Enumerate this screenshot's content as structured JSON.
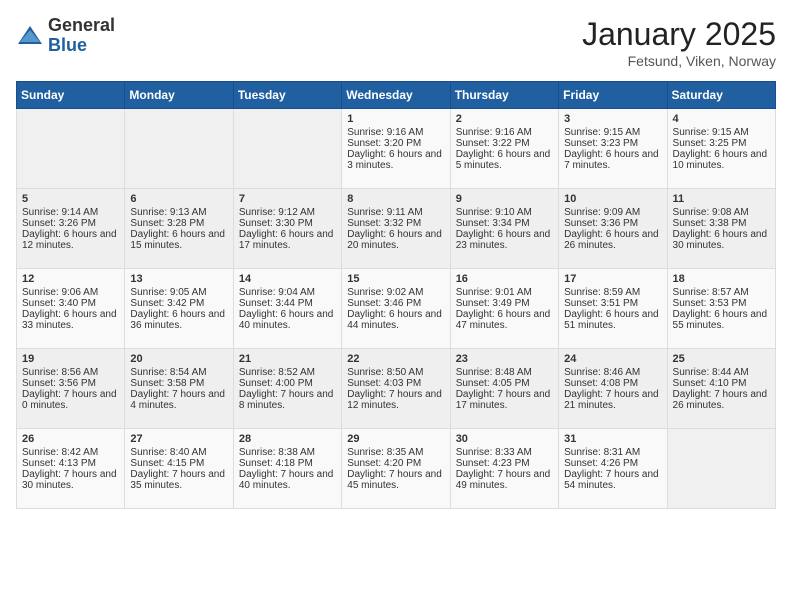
{
  "logo": {
    "general": "General",
    "blue": "Blue"
  },
  "title": {
    "month": "January 2025",
    "location": "Fetsund, Viken, Norway"
  },
  "weekdays": [
    "Sunday",
    "Monday",
    "Tuesday",
    "Wednesday",
    "Thursday",
    "Friday",
    "Saturday"
  ],
  "weeks": [
    [
      {
        "day": "",
        "sunrise": "",
        "sunset": "",
        "daylight": ""
      },
      {
        "day": "",
        "sunrise": "",
        "sunset": "",
        "daylight": ""
      },
      {
        "day": "",
        "sunrise": "",
        "sunset": "",
        "daylight": ""
      },
      {
        "day": "1",
        "sunrise": "Sunrise: 9:16 AM",
        "sunset": "Sunset: 3:20 PM",
        "daylight": "Daylight: 6 hours and 3 minutes."
      },
      {
        "day": "2",
        "sunrise": "Sunrise: 9:16 AM",
        "sunset": "Sunset: 3:22 PM",
        "daylight": "Daylight: 6 hours and 5 minutes."
      },
      {
        "day": "3",
        "sunrise": "Sunrise: 9:15 AM",
        "sunset": "Sunset: 3:23 PM",
        "daylight": "Daylight: 6 hours and 7 minutes."
      },
      {
        "day": "4",
        "sunrise": "Sunrise: 9:15 AM",
        "sunset": "Sunset: 3:25 PM",
        "daylight": "Daylight: 6 hours and 10 minutes."
      }
    ],
    [
      {
        "day": "5",
        "sunrise": "Sunrise: 9:14 AM",
        "sunset": "Sunset: 3:26 PM",
        "daylight": "Daylight: 6 hours and 12 minutes."
      },
      {
        "day": "6",
        "sunrise": "Sunrise: 9:13 AM",
        "sunset": "Sunset: 3:28 PM",
        "daylight": "Daylight: 6 hours and 15 minutes."
      },
      {
        "day": "7",
        "sunrise": "Sunrise: 9:12 AM",
        "sunset": "Sunset: 3:30 PM",
        "daylight": "Daylight: 6 hours and 17 minutes."
      },
      {
        "day": "8",
        "sunrise": "Sunrise: 9:11 AM",
        "sunset": "Sunset: 3:32 PM",
        "daylight": "Daylight: 6 hours and 20 minutes."
      },
      {
        "day": "9",
        "sunrise": "Sunrise: 9:10 AM",
        "sunset": "Sunset: 3:34 PM",
        "daylight": "Daylight: 6 hours and 23 minutes."
      },
      {
        "day": "10",
        "sunrise": "Sunrise: 9:09 AM",
        "sunset": "Sunset: 3:36 PM",
        "daylight": "Daylight: 6 hours and 26 minutes."
      },
      {
        "day": "11",
        "sunrise": "Sunrise: 9:08 AM",
        "sunset": "Sunset: 3:38 PM",
        "daylight": "Daylight: 6 hours and 30 minutes."
      }
    ],
    [
      {
        "day": "12",
        "sunrise": "Sunrise: 9:06 AM",
        "sunset": "Sunset: 3:40 PM",
        "daylight": "Daylight: 6 hours and 33 minutes."
      },
      {
        "day": "13",
        "sunrise": "Sunrise: 9:05 AM",
        "sunset": "Sunset: 3:42 PM",
        "daylight": "Daylight: 6 hours and 36 minutes."
      },
      {
        "day": "14",
        "sunrise": "Sunrise: 9:04 AM",
        "sunset": "Sunset: 3:44 PM",
        "daylight": "Daylight: 6 hours and 40 minutes."
      },
      {
        "day": "15",
        "sunrise": "Sunrise: 9:02 AM",
        "sunset": "Sunset: 3:46 PM",
        "daylight": "Daylight: 6 hours and 44 minutes."
      },
      {
        "day": "16",
        "sunrise": "Sunrise: 9:01 AM",
        "sunset": "Sunset: 3:49 PM",
        "daylight": "Daylight: 6 hours and 47 minutes."
      },
      {
        "day": "17",
        "sunrise": "Sunrise: 8:59 AM",
        "sunset": "Sunset: 3:51 PM",
        "daylight": "Daylight: 6 hours and 51 minutes."
      },
      {
        "day": "18",
        "sunrise": "Sunrise: 8:57 AM",
        "sunset": "Sunset: 3:53 PM",
        "daylight": "Daylight: 6 hours and 55 minutes."
      }
    ],
    [
      {
        "day": "19",
        "sunrise": "Sunrise: 8:56 AM",
        "sunset": "Sunset: 3:56 PM",
        "daylight": "Daylight: 7 hours and 0 minutes."
      },
      {
        "day": "20",
        "sunrise": "Sunrise: 8:54 AM",
        "sunset": "Sunset: 3:58 PM",
        "daylight": "Daylight: 7 hours and 4 minutes."
      },
      {
        "day": "21",
        "sunrise": "Sunrise: 8:52 AM",
        "sunset": "Sunset: 4:00 PM",
        "daylight": "Daylight: 7 hours and 8 minutes."
      },
      {
        "day": "22",
        "sunrise": "Sunrise: 8:50 AM",
        "sunset": "Sunset: 4:03 PM",
        "daylight": "Daylight: 7 hours and 12 minutes."
      },
      {
        "day": "23",
        "sunrise": "Sunrise: 8:48 AM",
        "sunset": "Sunset: 4:05 PM",
        "daylight": "Daylight: 7 hours and 17 minutes."
      },
      {
        "day": "24",
        "sunrise": "Sunrise: 8:46 AM",
        "sunset": "Sunset: 4:08 PM",
        "daylight": "Daylight: 7 hours and 21 minutes."
      },
      {
        "day": "25",
        "sunrise": "Sunrise: 8:44 AM",
        "sunset": "Sunset: 4:10 PM",
        "daylight": "Daylight: 7 hours and 26 minutes."
      }
    ],
    [
      {
        "day": "26",
        "sunrise": "Sunrise: 8:42 AM",
        "sunset": "Sunset: 4:13 PM",
        "daylight": "Daylight: 7 hours and 30 minutes."
      },
      {
        "day": "27",
        "sunrise": "Sunrise: 8:40 AM",
        "sunset": "Sunset: 4:15 PM",
        "daylight": "Daylight: 7 hours and 35 minutes."
      },
      {
        "day": "28",
        "sunrise": "Sunrise: 8:38 AM",
        "sunset": "Sunset: 4:18 PM",
        "daylight": "Daylight: 7 hours and 40 minutes."
      },
      {
        "day": "29",
        "sunrise": "Sunrise: 8:35 AM",
        "sunset": "Sunset: 4:20 PM",
        "daylight": "Daylight: 7 hours and 45 minutes."
      },
      {
        "day": "30",
        "sunrise": "Sunrise: 8:33 AM",
        "sunset": "Sunset: 4:23 PM",
        "daylight": "Daylight: 7 hours and 49 minutes."
      },
      {
        "day": "31",
        "sunrise": "Sunrise: 8:31 AM",
        "sunset": "Sunset: 4:26 PM",
        "daylight": "Daylight: 7 hours and 54 minutes."
      },
      {
        "day": "",
        "sunrise": "",
        "sunset": "",
        "daylight": ""
      }
    ]
  ]
}
